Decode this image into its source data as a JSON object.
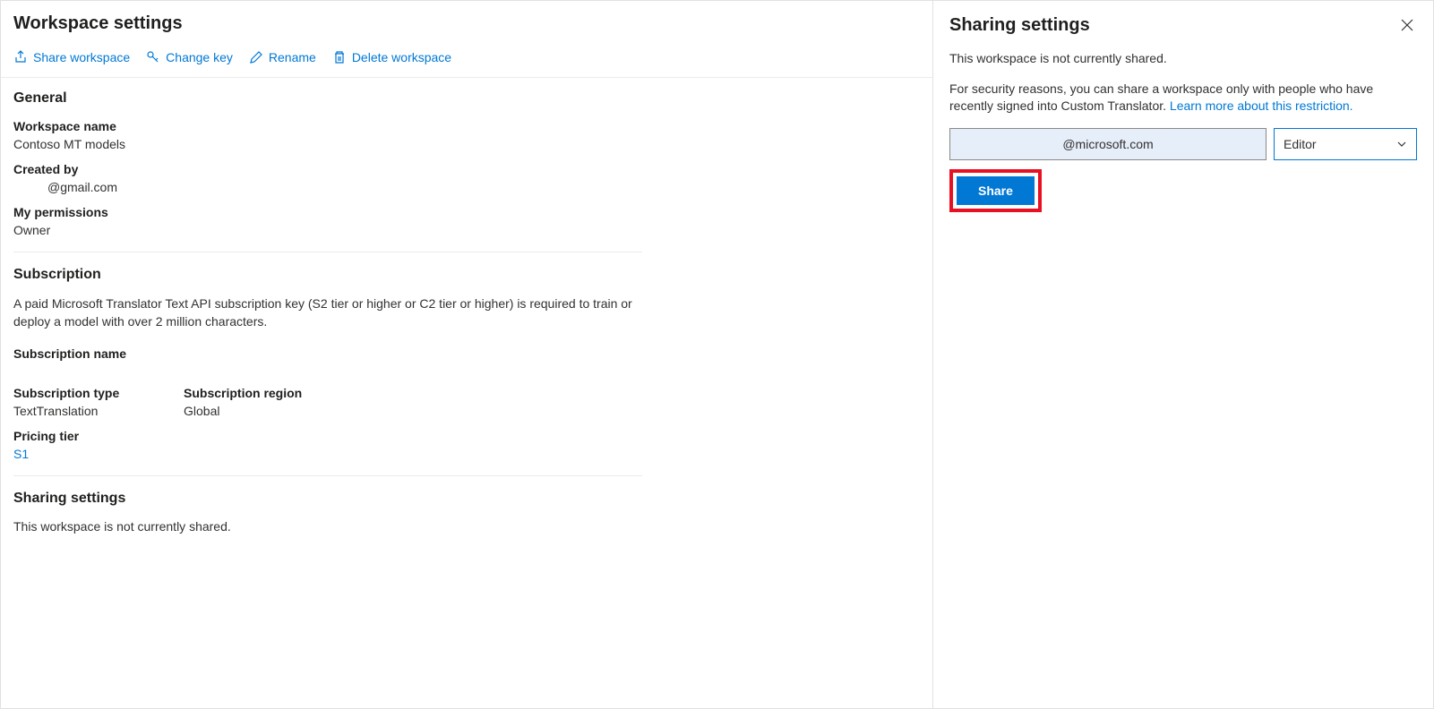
{
  "page": {
    "title": "Workspace settings"
  },
  "toolbar": {
    "share_label": "Share workspace",
    "change_key_label": "Change key",
    "rename_label": "Rename",
    "delete_label": "Delete workspace"
  },
  "general": {
    "title": "General",
    "name_label": "Workspace name",
    "name_value": "Contoso MT models",
    "created_by_label": "Created by",
    "created_by_value": "@gmail.com",
    "permissions_label": "My permissions",
    "permissions_value": "Owner"
  },
  "subscription": {
    "title": "Subscription",
    "description": "A paid Microsoft Translator Text API subscription key (S2 tier or higher or C2 tier or higher) is required to train or deploy a model with over 2 million characters.",
    "name_label": "Subscription name",
    "type_label": "Subscription type",
    "type_value": "TextTranslation",
    "region_label": "Subscription region",
    "region_value": "Global",
    "tier_label": "Pricing tier",
    "tier_value": "S1"
  },
  "sharing_main": {
    "title": "Sharing settings",
    "status": "This workspace is not currently shared."
  },
  "side": {
    "title": "Sharing settings",
    "status": "This workspace is not currently shared.",
    "security_text": "For security reasons, you can share a workspace only with people who have recently signed into Custom Translator. ",
    "learn_more": "Learn more about this restriction.",
    "email_value": "@microsoft.com",
    "role_value": "Editor",
    "share_button": "Share"
  }
}
